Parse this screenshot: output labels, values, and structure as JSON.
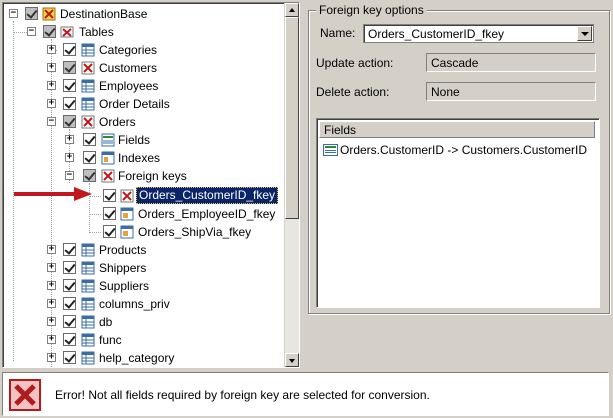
{
  "tree": {
    "root": "DestinationBase",
    "tables_label": "Tables",
    "items": [
      {
        "label": "Categories"
      },
      {
        "label": "Customers"
      },
      {
        "label": "Employees"
      },
      {
        "label": "Order Details"
      },
      {
        "label": "Orders"
      },
      {
        "label": "Fields"
      },
      {
        "label": "Indexes"
      },
      {
        "label": "Foreign keys"
      },
      {
        "label": "Orders_CustomerID_fkey"
      },
      {
        "label": "Orders_EmployeeID_fkey"
      },
      {
        "label": "Orders_ShipVia_fkey"
      },
      {
        "label": "Products"
      },
      {
        "label": "Shippers"
      },
      {
        "label": "Suppliers"
      },
      {
        "label": "columns_priv"
      },
      {
        "label": "db"
      },
      {
        "label": "func"
      },
      {
        "label": "help_category"
      }
    ]
  },
  "foreign_key_options": {
    "title": "Foreign key options",
    "name_label": "Name:",
    "name_value": "Orders_CustomerID_fkey",
    "update_label": "Update action:",
    "update_value": "Cascade",
    "delete_label": "Delete action:",
    "delete_value": "None",
    "fields_header": "Fields",
    "fields": [
      "Orders.CustomerID -> Customers.CustomerID"
    ]
  },
  "status": {
    "message": "Error! Not all fields required by foreign key are selected for conversion."
  },
  "colors": {
    "selection": "#0a246a",
    "error_red": "#b01c1c",
    "arrow_red": "#c0181c"
  }
}
